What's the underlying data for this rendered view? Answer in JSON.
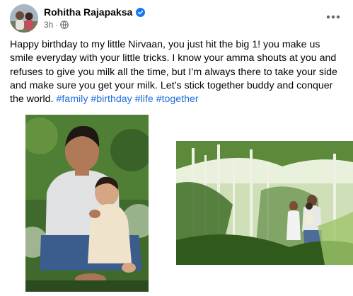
{
  "post": {
    "author": "Rohitha Rajapaksa",
    "time": "3h",
    "dot": "·",
    "text": "Happy birthday to my little Nirvaan, you just hit the big 1! you make us smile everyday with your little tricks. I know your amma shouts at you and refuses to give you milk all the time, but I’m always there to take your side and make sure you get your milk. Let’s stick together buddy and conquer the world.",
    "hashtags": [
      "#family",
      "#birthday",
      "#life",
      "#together"
    ]
  },
  "icons": {
    "avatar": "profile-photo",
    "verified": "verified-badge-icon",
    "audience": "globe-icon",
    "more": "more-horizontal-icon"
  },
  "colors": {
    "hashtag": "#216fdb",
    "verified": "#1877f2",
    "secondary_text": "#65676b"
  }
}
